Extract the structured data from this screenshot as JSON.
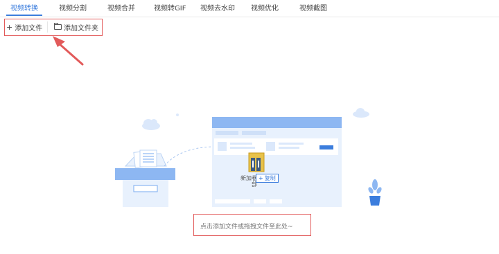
{
  "tabs": [
    {
      "label": "视频转换",
      "active": true
    },
    {
      "label": "视频分割",
      "active": false
    },
    {
      "label": "视频合并",
      "active": false
    },
    {
      "label": "视频转GIF",
      "active": false
    },
    {
      "label": "视频去水印",
      "active": false
    },
    {
      "label": "视频优化",
      "active": false
    },
    {
      "label": "视频截图",
      "active": false
    }
  ],
  "toolbar": {
    "add_file_label": "添加文件",
    "add_folder_label": "添加文件夹",
    "add_file_icon": "plus-icon",
    "add_folder_icon": "folder-icon"
  },
  "dropzone": {
    "hint": "点击添加文件或拖拽文件至此处~",
    "folder_label": "新加卷卷一部",
    "copy_badge": "复制"
  },
  "colors": {
    "accent": "#3b7ddd",
    "annotation": "#e25a5a",
    "illustration_blue": "#8db7f2",
    "illustration_light": "#e8f1fd"
  }
}
